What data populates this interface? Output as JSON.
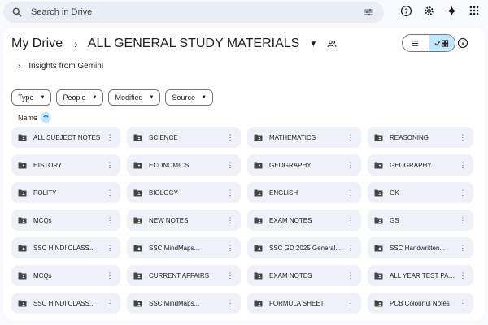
{
  "search": {
    "placeholder": "Search in Drive"
  },
  "breadcrumb": {
    "root": "My Drive",
    "current": "ALL GENERAL STUDY MATERIALS"
  },
  "insights": {
    "label": "Insights from Gemini"
  },
  "filters": [
    "Type",
    "People",
    "Modified",
    "Source"
  ],
  "sort": {
    "label": "Name"
  },
  "folders": [
    "ALL SUBJECT NOTES",
    "SCIENCE",
    "MATHEMATICS",
    "REASONING",
    "HISTORY",
    "ECONOMICS",
    "GEOGRAPHY",
    "GEOGRAPHY",
    "POLITY",
    "BIOLOGY",
    "ENGLISH",
    "GK",
    "MCQs",
    "NEW NOTES",
    "EXAM NOTES",
    "GS",
    "SSC HINDI CLASS...",
    "SSC MindMaps...",
    "SSC GD 2025 General...",
    "SSC Handwritten...",
    "MCQs",
    "CURRENT AFFAIRS",
    "EXAM NOTES",
    "ALL YEAR TEST PAPER",
    "SSC HINDI CLASS...",
    "SSC MindMaps...",
    "FORMULA SHEET",
    "PCB Colourful Notes"
  ],
  "colors": {
    "accent": "#c2e7ff",
    "surface": "#f8fafd",
    "card": "#eef2f8",
    "search": "#e9eef6"
  },
  "icons": {
    "search": "search-icon",
    "filter": "tune-icon",
    "help": "help-icon",
    "settings": "gear-icon",
    "gemini": "sparkle-icon",
    "apps": "apps-grid-icon",
    "folder": "folder-icon",
    "more": "more-vert-icon"
  }
}
